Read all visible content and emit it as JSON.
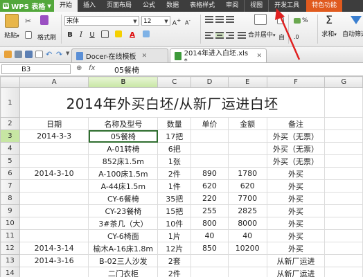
{
  "app": {
    "name": "WPS 表格"
  },
  "menu": {
    "tabs": [
      "开始",
      "插入",
      "页面布局",
      "公式",
      "数据",
      "表格样式",
      "审阅",
      "视图",
      "开发工具",
      "特色功能"
    ],
    "active": "开始"
  },
  "toolbar": {
    "paste": "粘贴",
    "format_painter": "格式刷",
    "font_name": "宋体",
    "font_size": "12",
    "merge_center": "合并居中",
    "wrap": "自",
    "sum": "求和",
    "filter": "自动筛选",
    "percent": "%",
    "bold": "B",
    "italic": "I",
    "underline": "U"
  },
  "doc_tabs": [
    {
      "label": "Docer-在线模板",
      "active": false
    },
    {
      "label": "2014年进入白坯.xls *",
      "active": true
    }
  ],
  "formula_bar": {
    "name_box": "B3",
    "fx": "fx",
    "formula": "05餐椅"
  },
  "grid": {
    "columns": [
      "A",
      "B",
      "C",
      "D",
      "E",
      "F",
      "G"
    ],
    "selected_col": "B",
    "selected_row": 3,
    "title": "2014年外买白坯/从新厂运进白坯",
    "headers": [
      "日期",
      "名称及型号",
      "数量",
      "单价",
      "金额",
      "备注",
      ""
    ],
    "rows": [
      {
        "num": "3",
        "cells": [
          "2014-3-3",
          "05餐椅",
          "17把",
          "",
          "",
          "外买（无票）",
          ""
        ]
      },
      {
        "num": "4",
        "cells": [
          "",
          "A-01转椅",
          "6把",
          "",
          "",
          "外买（无票）",
          ""
        ]
      },
      {
        "num": "5",
        "cells": [
          "",
          "852床1.5m",
          "1张",
          "",
          "",
          "外买（无票）",
          ""
        ]
      },
      {
        "num": "6",
        "cells": [
          "2014-3-10",
          "A-100床1.5m",
          "2件",
          "890",
          "1780",
          "外买",
          ""
        ]
      },
      {
        "num": "7",
        "cells": [
          "",
          "A-44床1.5m",
          "1件",
          "620",
          "620",
          "外买",
          ""
        ]
      },
      {
        "num": "8",
        "cells": [
          "",
          "CY-6餐椅",
          "35把",
          "220",
          "7700",
          "外买",
          ""
        ]
      },
      {
        "num": "9",
        "cells": [
          "",
          "CY-23餐椅",
          "15把",
          "255",
          "2825",
          "外买",
          ""
        ]
      },
      {
        "num": "10",
        "cells": [
          "",
          "3#茶几（大）",
          "10件",
          "800",
          "8000",
          "外买",
          ""
        ]
      },
      {
        "num": "11",
        "cells": [
          "",
          "CY-6椅面",
          "1片",
          "40",
          "40",
          "外买",
          ""
        ]
      },
      {
        "num": "12",
        "cells": [
          "2014-3-14",
          "榆木A-16床1.8m",
          "12片",
          "850",
          "10200",
          "外买",
          ""
        ]
      },
      {
        "num": "13",
        "cells": [
          "2014-3-16",
          "B-02三人沙发",
          "2套",
          "",
          "",
          "从新厂运进",
          ""
        ]
      },
      {
        "num": "14",
        "cells": [
          "",
          "二门衣柜",
          "2件",
          "",
          "",
          "从新厂运进",
          ""
        ]
      }
    ]
  },
  "colors": {
    "app_green": "#52a73b",
    "menubar": "#3d3d3d",
    "special_tab": "#e05a1e",
    "selection": "#2f6e2f",
    "annotation_arrow": "#e02020"
  }
}
